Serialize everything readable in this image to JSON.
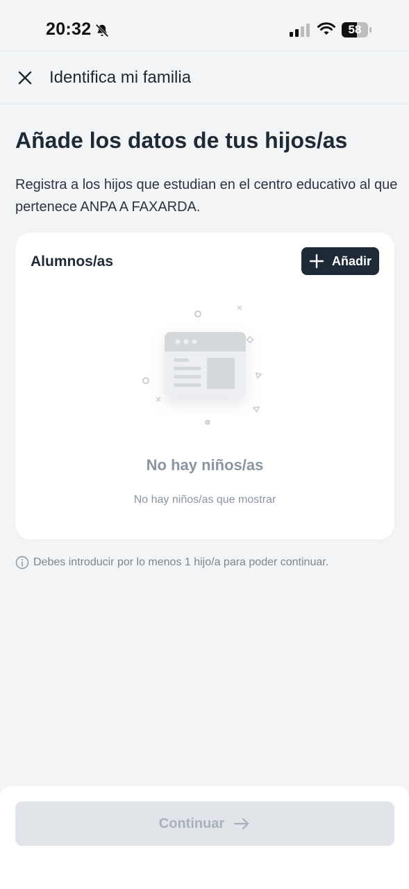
{
  "status_bar": {
    "time": "20:32",
    "battery": "58",
    "icons": [
      "bell-slash-icon",
      "signal-icon",
      "wifi-icon",
      "battery-icon"
    ]
  },
  "header": {
    "close_icon": "close-icon",
    "title": "Identifica mi familia"
  },
  "main": {
    "title": "Añade los datos de tus hijos/as",
    "description": "Registra a los hijos que estudian en el centro educativo al que pertenece ANPA A FAXARDA."
  },
  "students_card": {
    "title": "Alumnos/as",
    "add_button_label": "Añadir",
    "empty_title": "No hay niños/as",
    "empty_subtitle": "No hay niños/as que mostrar"
  },
  "info_note": {
    "icon": "info-icon",
    "text": "Debes introducir por lo menos 1 hijo/a para poder continuar."
  },
  "footer": {
    "continue_label": "Continuar",
    "continue_enabled": false
  },
  "colors": {
    "background": "#f3f4f6",
    "primary_dark": "#1f2a37",
    "muted_text": "#8b95a1",
    "disabled_button": "#e1e5ea"
  }
}
